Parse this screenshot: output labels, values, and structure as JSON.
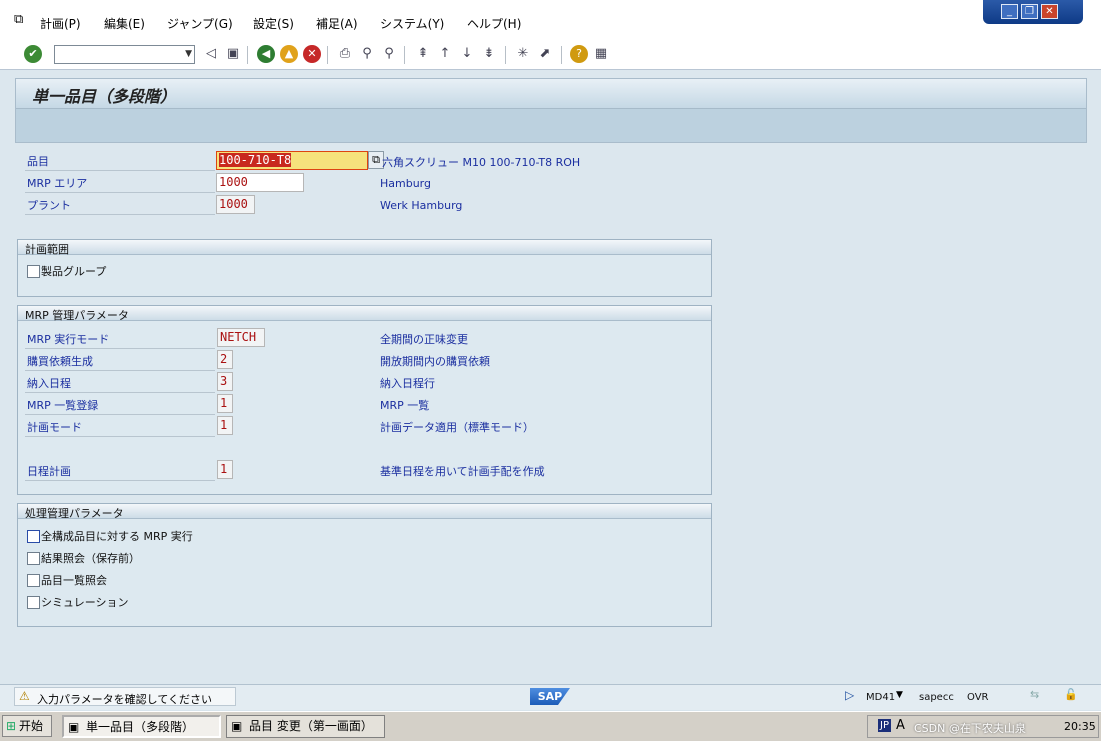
{
  "menu": [
    "計画(P)",
    "編集(E)",
    "ジャンプ(G)",
    "設定(S)",
    "補足(A)",
    "システム(Y)",
    "ヘルプ(H)"
  ],
  "window_controls": {
    "minimize": "_",
    "restore": "❐",
    "close": "✕"
  },
  "toolbar": {
    "command_value": ""
  },
  "page_title": "単一品目（多段階）",
  "header_fields": [
    {
      "label": "品目",
      "value": "100-710-T8",
      "desc": "六角スクリュー M10 100-710-T8 ROH"
    },
    {
      "label": "MRP エリア",
      "value": "1000",
      "desc": "Hamburg"
    },
    {
      "label": "プラント",
      "value": "1000",
      "desc": "Werk Hamburg"
    }
  ],
  "group_planning_scope": {
    "title": "計画範囲",
    "checkbox_label": "製品グループ",
    "checked": false
  },
  "group_mrp": {
    "title": "MRP 管理パラメータ",
    "rows": [
      {
        "label": "MRP 実行モード",
        "value": "NETCH",
        "desc": "全期間の正味変更"
      },
      {
        "label": "購買依頼生成",
        "value": "2",
        "desc": "開放期間内の購買依頼"
      },
      {
        "label": "納入日程",
        "value": "3",
        "desc": "納入日程行"
      },
      {
        "label": "MRP 一覧登録",
        "value": "1",
        "desc": "MRP 一覧"
      },
      {
        "label": "計画モード",
        "value": "1",
        "desc": "計画データ適用（標準モード）"
      },
      {
        "label": "日程計画",
        "value": "1",
        "desc": "基準日程を用いて計画手配を作成"
      }
    ]
  },
  "group_process": {
    "title": "処理管理パラメータ",
    "checkboxes": [
      {
        "label": "全構成品目に対する MRP 実行",
        "checked": false
      },
      {
        "label": "結果照会（保存前）",
        "checked": false
      },
      {
        "label": "品目一覧照会",
        "checked": false
      },
      {
        "label": "シミュレーション",
        "checked": false
      }
    ]
  },
  "statusbar": {
    "message": "入力パラメータを確認してください",
    "logo": "SAP",
    "transaction": "MD41",
    "server": "sapecc",
    "mode": "OVR"
  },
  "taskbar": {
    "start": "开始",
    "tasks": [
      "単一品目（多段階）",
      "品目 変更（第一画面）"
    ],
    "tray_lang": "JP",
    "watermark": "CSDN @在下农夫山泉",
    "clock": "20:35"
  }
}
